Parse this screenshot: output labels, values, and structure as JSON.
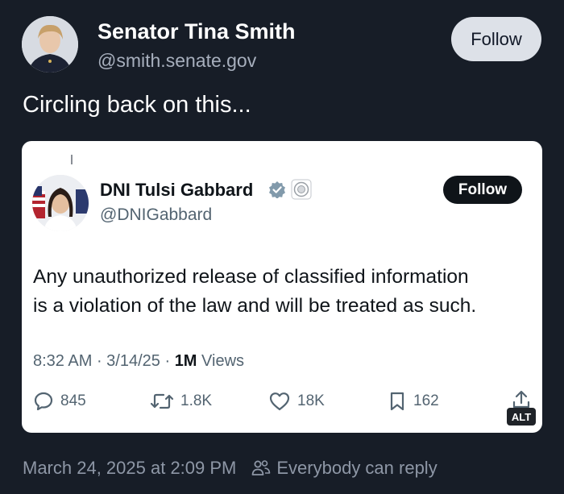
{
  "author": {
    "name": "Senator Tina Smith",
    "handle": "@smith.senate.gov",
    "follow_label": "Follow"
  },
  "post": {
    "text": "Circling back on this..."
  },
  "embedded_post": {
    "name": "DNI Tulsi Gabbard",
    "handle": "@DNIGabbard",
    "follow_label": "Follow",
    "body_lines": [
      "Any unauthorized release of classified information",
      "is a violation of the law and will be treated as such."
    ],
    "time": "8:32 AM",
    "date": "3/14/25",
    "views_count": "1M",
    "views_label": "Views",
    "replies": "845",
    "reposts": "1.8K",
    "likes": "18K",
    "bookmarks": "162",
    "alt_label": "ALT"
  },
  "footer": {
    "timestamp": "March 24, 2025 at 2:09 PM",
    "reply_setting": "Everybody can reply"
  },
  "colors": {
    "background": "#171d27",
    "card": "#ffffff",
    "follow_button": "#dde1e8",
    "muted_text": "#8e97a6"
  }
}
